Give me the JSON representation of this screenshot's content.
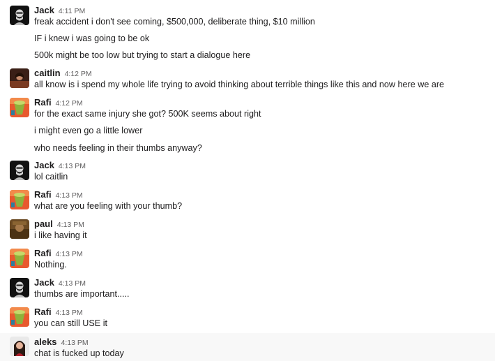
{
  "messages": [
    {
      "author": "Jack",
      "time": "4:11 PM",
      "avatar": "jack-avatar-icon",
      "lines": [
        "freak accident i don't see coming, $500,000, deliberate thing, $10 million",
        "IF i knew i was going to be ok",
        "500k might be too low but trying to start a dialogue here"
      ]
    },
    {
      "author": "caitlin",
      "time": "4:12 PM",
      "avatar": "caitlin-avatar-icon",
      "lines": [
        "all know is i spend my whole life trying to avoid thinking about terrible things like this and now here we are"
      ]
    },
    {
      "author": "Rafi",
      "time": "4:12 PM",
      "avatar": "rafi-avatar-icon",
      "lines": [
        "for the exact same injury she got? 500K seems about right",
        "i might even go a little lower",
        "who needs feeling in their thumbs anyway?"
      ]
    },
    {
      "author": "Jack",
      "time": "4:13 PM",
      "avatar": "jack-avatar-icon",
      "lines": [
        "lol caitlin"
      ]
    },
    {
      "author": "Rafi",
      "time": "4:13 PM",
      "avatar": "rafi-avatar-icon",
      "lines": [
        "what are you feeling with your thumb?"
      ]
    },
    {
      "author": "paul",
      "time": "4:13 PM",
      "avatar": "paul-avatar-icon",
      "lines": [
        "i like having it"
      ]
    },
    {
      "author": "Rafi",
      "time": "4:13 PM",
      "avatar": "rafi-avatar-icon",
      "lines": [
        "Nothing."
      ]
    },
    {
      "author": "Jack",
      "time": "4:13 PM",
      "avatar": "jack-avatar-icon",
      "lines": [
        "thumbs are important....."
      ]
    },
    {
      "author": "Rafi",
      "time": "4:13 PM",
      "avatar": "rafi-avatar-icon",
      "lines": [
        "you can still USE it"
      ]
    },
    {
      "author": "aleks",
      "time": "4:13 PM",
      "avatar": "aleks-avatar-icon",
      "lines": [
        "chat is fucked up today"
      ]
    }
  ]
}
